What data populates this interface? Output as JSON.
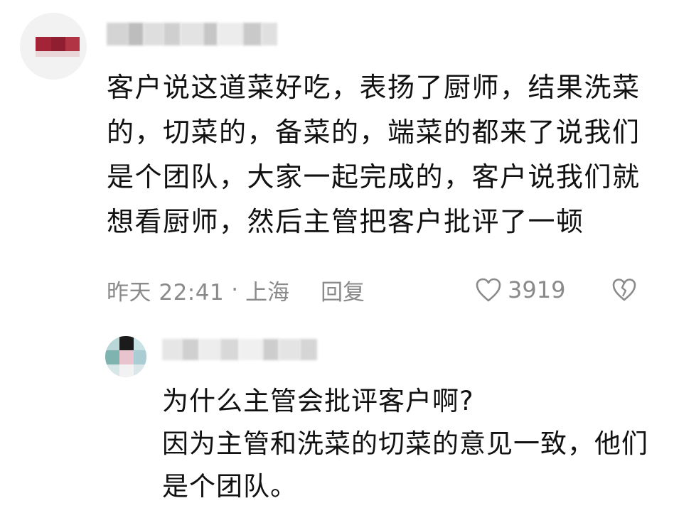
{
  "comment": {
    "text": "客户说这道菜好吃，表扬了厨师，结果洗菜的，切菜的，备菜的，端菜的都来了说我们是个团队，大家一起完成的，客户说我们就想看厨师，然后主管把客户批评了一顿",
    "time": "昨天 22:41",
    "dot": "·",
    "location": "上海",
    "reply_label": "回复",
    "like_count": "3919",
    "icons": {
      "like": "heart-outline-icon",
      "dislike": "broken-heart-icon"
    },
    "colors": {
      "meta_text": "#8a8a8a",
      "body_text": "#111111"
    }
  },
  "reply": {
    "line1": "为什么主管会批评客户啊?",
    "line2": "因为主管和洗菜的切菜的意见一致，他们是个团队。"
  }
}
